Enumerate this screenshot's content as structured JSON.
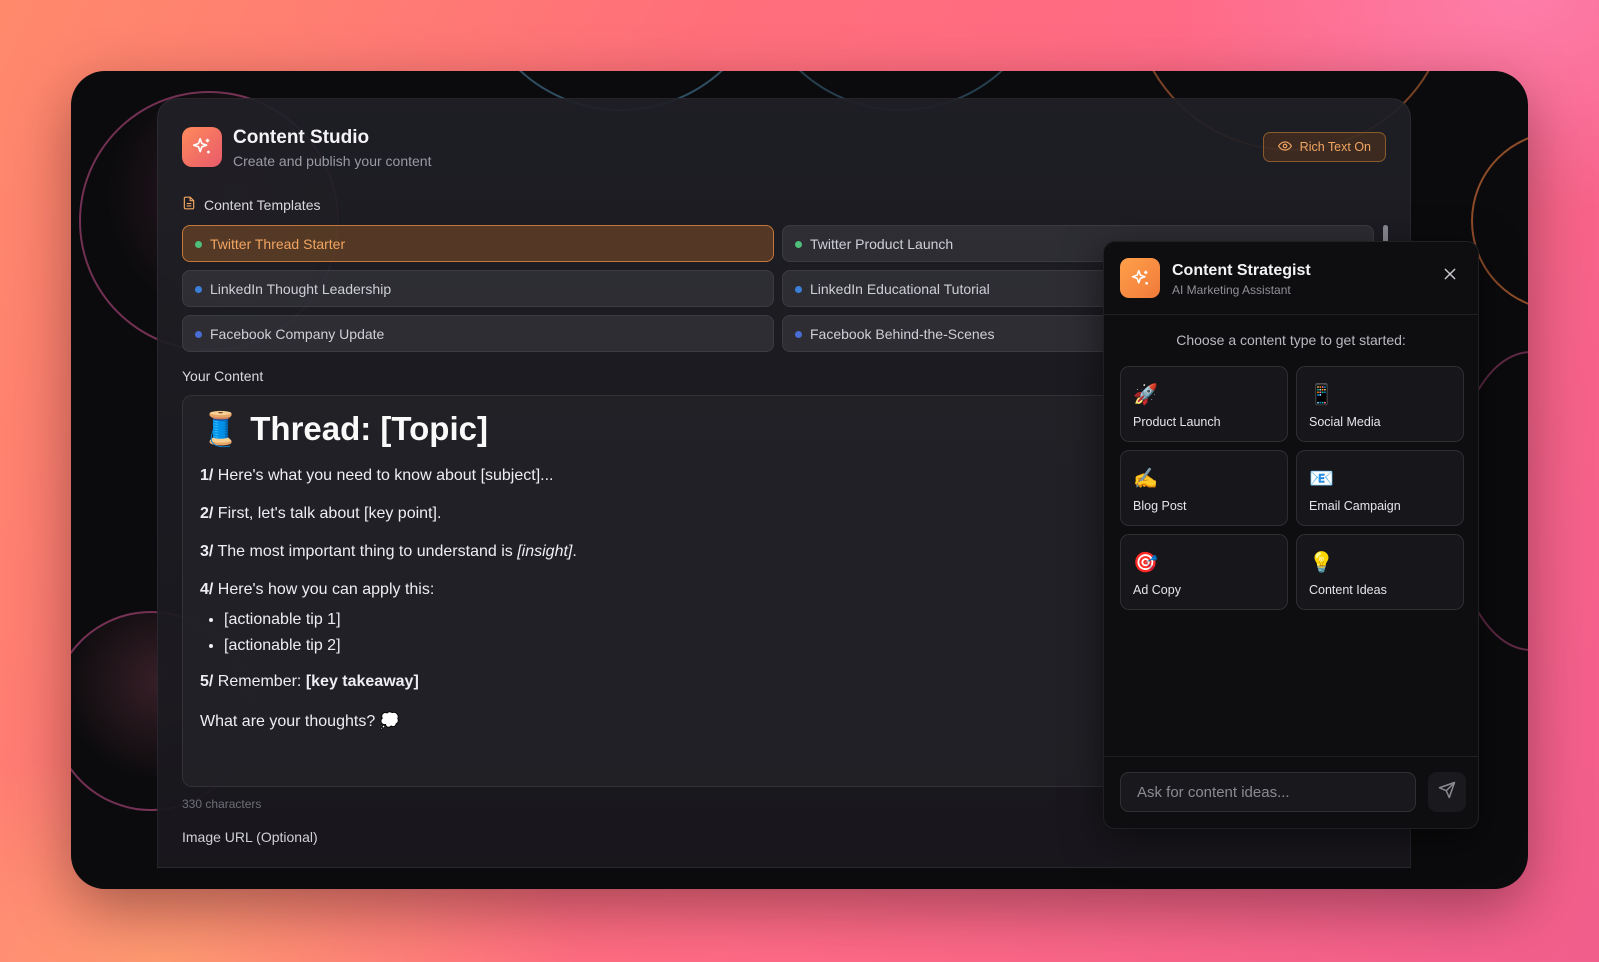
{
  "app": {
    "title": "Content Studio",
    "subtitle": "Create and publish your content",
    "rich_text_label": "Rich Text On"
  },
  "templates": {
    "section_label": "Content Templates",
    "items": [
      {
        "label": "Twitter Thread Starter",
        "color": "#4fc07a",
        "active": true
      },
      {
        "label": "Twitter Product Launch",
        "color": "#4fc07a",
        "active": false
      },
      {
        "label": "LinkedIn Thought Leadership",
        "color": "#3b7fd9",
        "active": false
      },
      {
        "label": "LinkedIn Educational Tutorial",
        "color": "#3b7fd9",
        "active": false
      },
      {
        "label": "Facebook Company Update",
        "color": "#4a6cd4",
        "active": false
      },
      {
        "label": "Facebook Behind-the-Scenes",
        "color": "#4a6cd4",
        "active": false
      }
    ]
  },
  "editor": {
    "section_label": "Your Content",
    "heading": "🧵 Thread: [Topic]",
    "p1_num": "1/",
    "p1_text": " Here's what you need to know about [subject]...",
    "p2_num": "2/",
    "p2_text": " First, let's talk about [key point].",
    "p3_num": "3/",
    "p3_text": " The most important thing to understand is ",
    "p3_italic": "[insight]",
    "p3_end": ".",
    "p4_num": "4/",
    "p4_text": " Here's how you can apply this:",
    "tips": [
      "[actionable tip 1]",
      "[actionable tip 2]"
    ],
    "p5_num": "5/",
    "p5_text": " Remember: ",
    "p5_bold": "[key takeaway]",
    "closing": "What are your thoughts? 💭",
    "char_count": "330 characters",
    "image_label": "Image URL (Optional)"
  },
  "strategist": {
    "title": "Content Strategist",
    "subtitle": "AI Marketing Assistant",
    "prompt": "Choose a content type to get started:",
    "choices": [
      {
        "emoji": "🚀",
        "label": "Product Launch"
      },
      {
        "emoji": "📱",
        "label": "Social Media"
      },
      {
        "emoji": "✍️",
        "label": "Blog Post"
      },
      {
        "emoji": "📧",
        "label": "Email Campaign"
      },
      {
        "emoji": "🎯",
        "label": "Ad Copy"
      },
      {
        "emoji": "💡",
        "label": "Content Ideas"
      }
    ],
    "input_placeholder": "Ask for content ideas..."
  },
  "icons": {
    "logo": "sparkles-icon",
    "rich_text": "eye-icon",
    "templates": "document-icon",
    "close": "close-icon",
    "send": "send-icon"
  },
  "colors": {
    "accent": "#f2a560",
    "brand_gradient_start": "#ff8a5c",
    "brand_gradient_end": "#e85a6a"
  }
}
